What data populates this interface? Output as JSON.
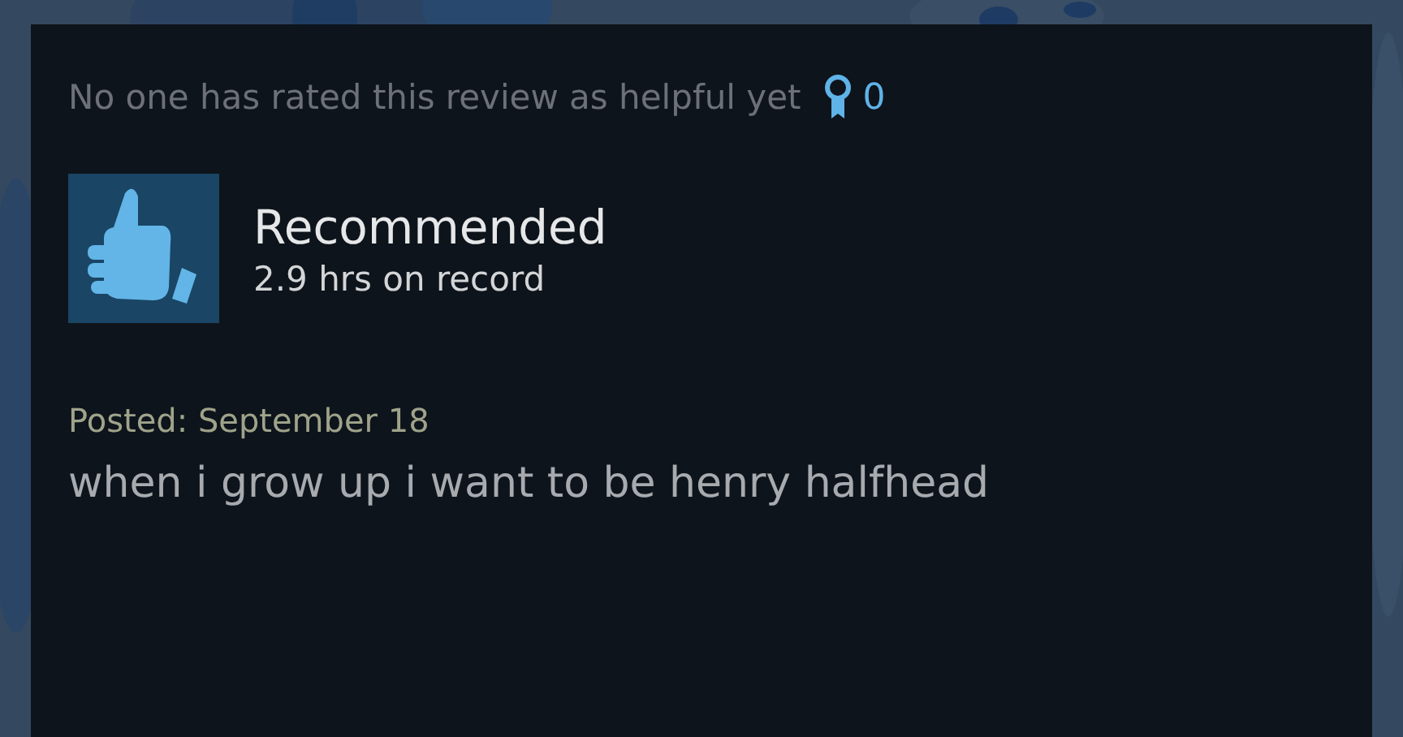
{
  "helpful_text": "No one has rated this review as helpful yet",
  "award_count": "0",
  "verdict": {
    "recommended": true,
    "label": "Recommended",
    "hours": "2.9 hrs on record"
  },
  "posted": "Posted: September 18",
  "review_text": "when i grow up i want to be henry halfhead"
}
